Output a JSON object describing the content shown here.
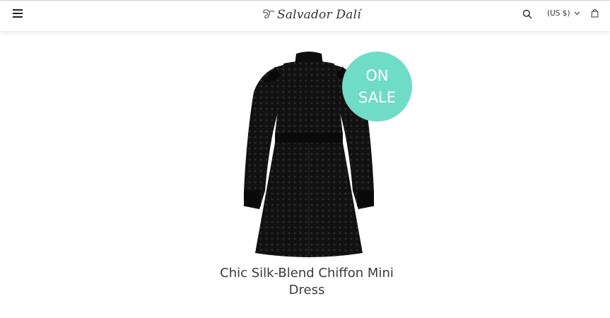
{
  "header": {
    "menu_icon": "hamburger-menu-icon",
    "logo_text": "Salvador Dalí",
    "search_icon": "search-icon",
    "currency_label": "(US $)",
    "currency_chevron_icon": "chevron-down-icon",
    "cart_icon": "shopping-bag-icon"
  },
  "product": {
    "badge_line1": "ON",
    "badge_line2": "SALE",
    "badge_color": "#6fdcc7",
    "image": "black-lace-mini-dress-image",
    "title": "Chic Silk-Blend Chiffon Mini Dress"
  }
}
